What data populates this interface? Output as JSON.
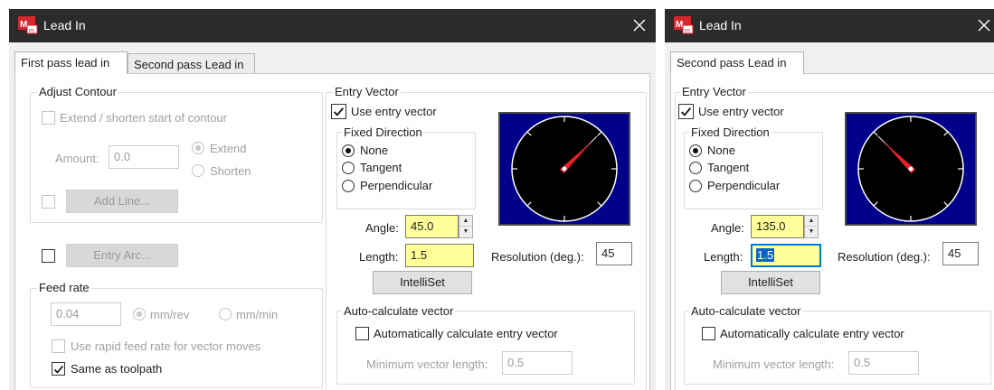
{
  "colors": {
    "titlebar_bg": "#2b2b2b",
    "dialog_bg": "#f0f0f0",
    "input_highlight": "#ffff99",
    "dial_bg": "#00008b",
    "dial_face": "#000000",
    "dial_needle": "#e8202a",
    "selection": "#0a64c8"
  },
  "left": {
    "title": "Lead In",
    "app_icon": "mastercam-app-icon",
    "close_icon": "close-icon",
    "tabs": [
      {
        "label": "First pass lead in",
        "active": true
      },
      {
        "label": "Second pass Lead in",
        "active": false
      }
    ],
    "adjust_contour": {
      "label": "Adjust Contour",
      "extend_shorten_label": "Extend / shorten start of contour",
      "extend_shorten_checked": false,
      "amount_label": "Amount:",
      "amount_value": "0.0",
      "extend_label": "Extend",
      "shorten_label": "Shorten",
      "selected_mode": "Extend",
      "add_line_checked": false,
      "add_line_label": "Add Line..."
    },
    "entry_arc": {
      "checked": false,
      "label": "Entry Arc..."
    },
    "feed_rate": {
      "label": "Feed rate",
      "value": "0.04",
      "mm_rev_label": "mm/rev",
      "mm_min_label": "mm/min",
      "selected_unit": "mm/rev",
      "use_rapid_label": "Use rapid feed rate for vector moves",
      "use_rapid_checked": false,
      "same_as_label": "Same as toolpath",
      "same_as_checked": true
    },
    "entry_vector": {
      "label": "Entry Vector",
      "use_entry_label": "Use entry vector",
      "use_entry_checked": true,
      "fixed_direction_label": "Fixed Direction",
      "options": [
        "None",
        "Tangent",
        "Perpendicular"
      ],
      "selected_option": "None",
      "angle_label": "Angle:",
      "angle_value": "45.0",
      "length_label": "Length:",
      "length_value": "1.5",
      "resolution_label": "Resolution (deg.):",
      "resolution_value": "45",
      "intelliset_label": "IntelliSet",
      "dial_angle_deg": 45
    },
    "auto_calc": {
      "label": "Auto-calculate vector",
      "auto_label": "Automatically calculate entry vector",
      "auto_checked": false,
      "min_length_label": "Minimum vector length:",
      "min_length_value": "0.5"
    }
  },
  "right": {
    "title": "Lead In",
    "app_icon": "mastercam-app-icon",
    "close_icon": "close-icon",
    "tabs": [
      {
        "label": "Second pass Lead in",
        "active": true
      }
    ],
    "entry_vector": {
      "label": "Entry Vector",
      "use_entry_label": "Use entry vector",
      "use_entry_checked": true,
      "fixed_direction_label": "Fixed Direction",
      "options": [
        "None",
        "Tangent",
        "Perpendicular"
      ],
      "selected_option": "None",
      "angle_label": "Angle:",
      "angle_value": "135.0",
      "length_label": "Length:",
      "length_value": "1.5",
      "resolution_label": "Resolution (deg.):",
      "resolution_value": "45",
      "intelliset_label": "IntelliSet",
      "dial_angle_deg": 135
    },
    "auto_calc": {
      "label": "Auto-calculate vector",
      "auto_label": "Automatically calculate entry vector",
      "auto_checked": false,
      "min_length_label": "Minimum vector length:",
      "min_length_value": "0.5"
    }
  }
}
